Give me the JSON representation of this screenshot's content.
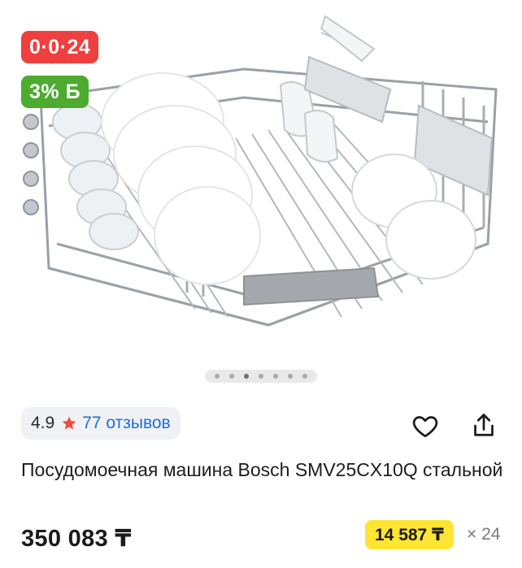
{
  "gallery": {
    "image_alt": "Посудомоечная машина Bosch SMV25CX10Q",
    "badge_discount": "0·0·24",
    "badge_bonus": "3% Б",
    "dots_count": 7,
    "active_dot": 3
  },
  "rating": {
    "score": "4.9",
    "reviews": "77 отзывов"
  },
  "actions": {
    "favorite": "heart-icon",
    "share": "share-icon"
  },
  "product": {
    "title": "Посудомоечная машина Bosch SMV25CX10Q стальной",
    "price": "350 083 ₸",
    "installment": "14 587 ₸",
    "months": "× 24"
  },
  "colors": {
    "discount_badge": "#ef3f3e",
    "bonus_badge": "#4dab2f",
    "installment_bg": "#ffe533",
    "link": "#1e6fd9",
    "star": "#f0483e"
  }
}
